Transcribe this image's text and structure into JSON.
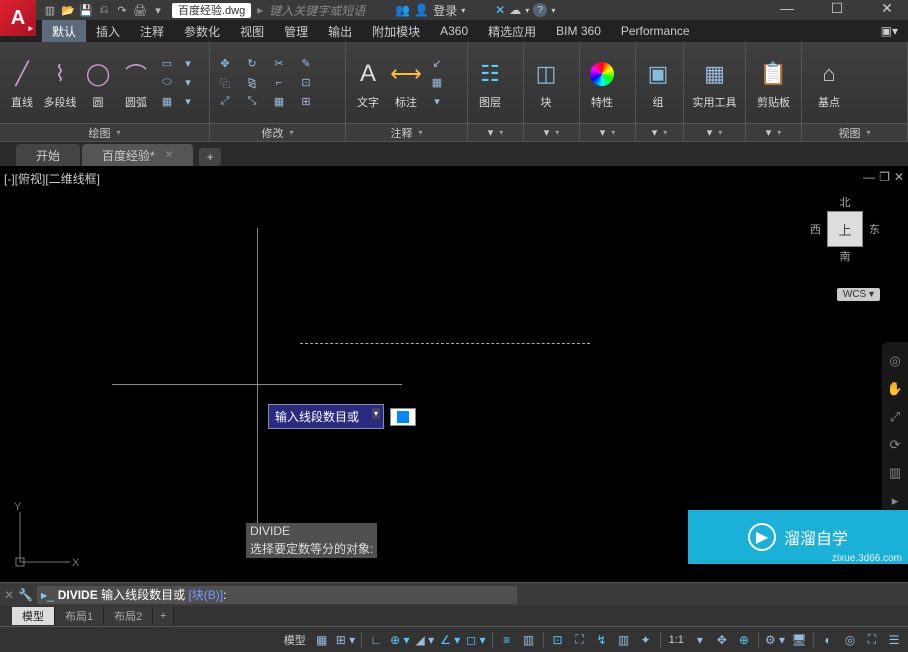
{
  "titlebar": {
    "filename": "百度经验.dwg",
    "search_placeholder": "键入关键字或短语",
    "login": "登录",
    "qat": [
      "▥",
      "⎌",
      "↷",
      "🖨",
      "▾"
    ]
  },
  "menus": [
    "默认",
    "插入",
    "注释",
    "参数化",
    "视图",
    "管理",
    "输出",
    "附加模块",
    "A360",
    "精选应用",
    "BIM 360",
    "Performance"
  ],
  "ribbon": {
    "draw": {
      "title": "绘图",
      "line": "直线",
      "pline": "多段线",
      "circle": "圆",
      "arc": "圆弧"
    },
    "modify": {
      "title": "修改"
    },
    "annot": {
      "title": "注释",
      "text": "文字",
      "dim": "标注"
    },
    "layer": {
      "title": "图层"
    },
    "block": {
      "title": "块"
    },
    "prop": {
      "title": "特性"
    },
    "group": {
      "title": "组"
    },
    "util": {
      "title": "实用工具"
    },
    "clip": {
      "title": "剪贴板"
    },
    "view": {
      "title": "视图",
      "base": "基点"
    }
  },
  "filetabs": {
    "start": "开始",
    "file": "百度经验*"
  },
  "viewport": {
    "label": "[-][俯视][二维线框]",
    "min": "—",
    "max": "❐",
    "close": "✕"
  },
  "viewcube": {
    "top": "上",
    "n": "北",
    "s": "南",
    "e": "东",
    "w": "西",
    "wcs": "WCS"
  },
  "prompt": {
    "text": "输入线段数目或"
  },
  "cmd": {
    "hist1": "DIVIDE",
    "hist2": "选择要定数等分的对象:",
    "name": "DIVIDE",
    "rest": "输入线段数目或",
    "opt": "[块(B)]",
    "colon": ":"
  },
  "layout": {
    "model": "模型",
    "l1": "布局1",
    "l2": "布局2"
  },
  "status": {
    "model": "模型",
    "scale": "1:1",
    "ann": "▲"
  },
  "watermark": {
    "text": "溜溜自学",
    "url": "zixue.3d66.com"
  },
  "icons": {
    "grid": "▦",
    "snap": "⊞",
    "ortho": "∟",
    "polar": "⊕",
    "osnap": "◇",
    "dyn": "⊡",
    "lw": "≡",
    "trans": "◐",
    "cycle": "◎",
    "iso": "◢",
    "gear": "⚙",
    "full": "⛶",
    "cust": "☰",
    "person": "👤",
    "people": "👥",
    "x": "✕",
    "help": "?",
    "cloud": "☁"
  }
}
